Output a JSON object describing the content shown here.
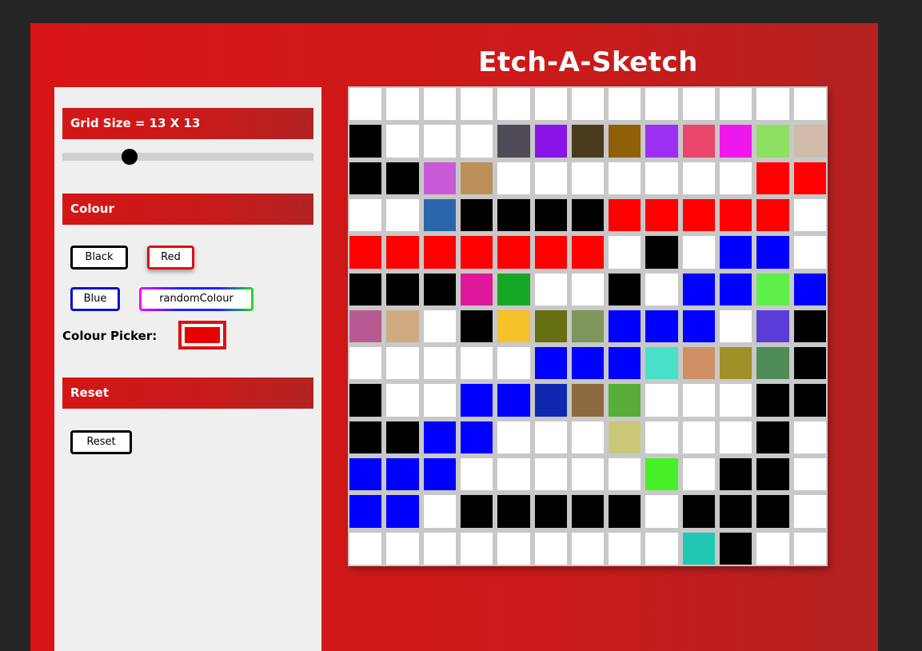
{
  "app": {
    "title": "Etch-A-Sketch"
  },
  "panel": {
    "grid_size": {
      "header": "Grid Size = 13 X 13",
      "slider_value": 13,
      "slider_min": 2,
      "slider_max": 100
    },
    "colour": {
      "header": "Colour",
      "buttons": {
        "black": "Black",
        "red": "Red",
        "blue": "Blue",
        "random": "randomColour"
      },
      "picker_label": "Colour Picker:",
      "picker_value": "#e60000"
    },
    "reset": {
      "header": "Reset",
      "button": "Reset"
    }
  },
  "grid": {
    "size": 13,
    "cells": [
      [
        "#ffffff",
        "#ffffff",
        "#ffffff",
        "#ffffff",
        "#ffffff",
        "#ffffff",
        "#ffffff",
        "#ffffff",
        "#ffffff",
        "#ffffff",
        "#ffffff",
        "#ffffff",
        "#ffffff"
      ],
      [
        "#000000",
        "#ffffff",
        "#ffffff",
        "#ffffff",
        "#4f4a55",
        "#8a14e8",
        "#4a3b1c",
        "#8f6008",
        "#9d2ff2",
        "#e8466a",
        "#ef18ec",
        "#8ee060",
        "#cfbba8"
      ],
      [
        "#000000",
        "#000000",
        "#c85ad8",
        "#bd8f5a",
        "#ffffff",
        "#ffffff",
        "#ffffff",
        "#ffffff",
        "#ffffff",
        "#ffffff",
        "#ffffff",
        "#ff0000",
        "#ff0000"
      ],
      [
        "#ffffff",
        "#ffffff",
        "#2b66aa",
        "#000000",
        "#000000",
        "#000000",
        "#000000",
        "#ff0000",
        "#ff0000",
        "#ff0000",
        "#ff0000",
        "#ff0000",
        "#ffffff"
      ],
      [
        "#ff0000",
        "#ff0000",
        "#ff0000",
        "#ff0000",
        "#ff0000",
        "#ff0000",
        "#ff0000",
        "#ffffff",
        "#000000",
        "#ffffff",
        "#0000ff",
        "#0000ff",
        "#ffffff"
      ],
      [
        "#000000",
        "#000000",
        "#000000",
        "#e0179a",
        "#16a625",
        "#ffffff",
        "#ffffff",
        "#000000",
        "#ffffff",
        "#0000ff",
        "#0000ff",
        "#5ef048",
        "#0000ff"
      ],
      [
        "#b85a92",
        "#d0aa80",
        "#ffffff",
        "#000000",
        "#f6c028",
        "#687014",
        "#7e965c",
        "#0000ff",
        "#0000ff",
        "#0000ff",
        "#ffffff",
        "#5c3cd6",
        "#000000"
      ],
      [
        "#ffffff",
        "#ffffff",
        "#ffffff",
        "#ffffff",
        "#ffffff",
        "#0000ff",
        "#0000ff",
        "#0000ff",
        "#48e0c8",
        "#d09064",
        "#a09028",
        "#508c58",
        "#000000"
      ],
      [
        "#000000",
        "#ffffff",
        "#ffffff",
        "#0000ff",
        "#0000ff",
        "#1028b0",
        "#8c6a40",
        "#58ac38",
        "#ffffff",
        "#ffffff",
        "#ffffff",
        "#000000",
        "#000000"
      ],
      [
        "#000000",
        "#000000",
        "#0000ff",
        "#0000ff",
        "#ffffff",
        "#ffffff",
        "#ffffff",
        "#c8c878",
        "#ffffff",
        "#ffffff",
        "#ffffff",
        "#000000",
        "#ffffff"
      ],
      [
        "#0000ff",
        "#0000ff",
        "#0000ff",
        "#ffffff",
        "#ffffff",
        "#ffffff",
        "#ffffff",
        "#ffffff",
        "#48f028",
        "#ffffff",
        "#000000",
        "#000000",
        "#ffffff"
      ],
      [
        "#0000ff",
        "#0000ff",
        "#ffffff",
        "#000000",
        "#000000",
        "#000000",
        "#000000",
        "#000000",
        "#ffffff",
        "#000000",
        "#000000",
        "#000000",
        "#ffffff"
      ],
      [
        "#ffffff",
        "#ffffff",
        "#ffffff",
        "#ffffff",
        "#ffffff",
        "#ffffff",
        "#ffffff",
        "#ffffff",
        "#ffffff",
        "#20c8b4",
        "#000000",
        "#ffffff",
        "#ffffff"
      ]
    ]
  }
}
